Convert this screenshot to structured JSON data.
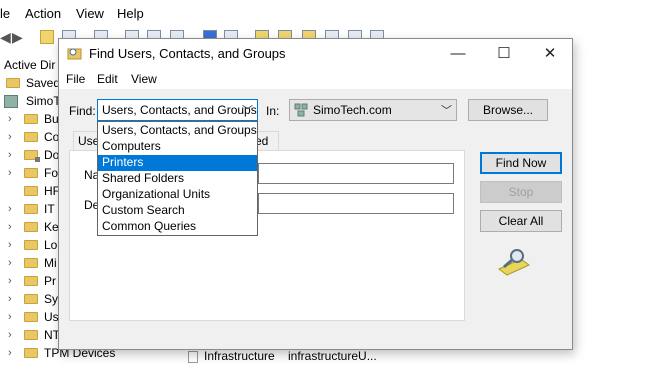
{
  "background": {
    "menu": [
      "le",
      "Action",
      "View",
      "Help"
    ],
    "tree": {
      "header": "Active Dir",
      "items": [
        {
          "label": "Saved",
          "type": "folder",
          "chevron": false
        },
        {
          "label": "SimoT",
          "type": "domain",
          "chevron": false
        },
        {
          "label": "Bu",
          "type": "folder",
          "chevron": true
        },
        {
          "label": "Co",
          "type": "folder",
          "chevron": true
        },
        {
          "label": "Do",
          "type": "folder",
          "chevron": true
        },
        {
          "label": "Fo",
          "type": "folder",
          "chevron": true
        },
        {
          "label": "HF",
          "type": "folder",
          "chevron": false
        },
        {
          "label": "IT",
          "type": "folder",
          "chevron": true
        },
        {
          "label": "Ke",
          "type": "folder",
          "chevron": true
        },
        {
          "label": "Lo",
          "type": "folder",
          "chevron": true
        },
        {
          "label": "Mi",
          "type": "folder",
          "chevron": true
        },
        {
          "label": "Pr",
          "type": "folder",
          "chevron": true
        },
        {
          "label": "Sy",
          "type": "folder",
          "chevron": true
        },
        {
          "label": "Us",
          "type": "folder",
          "chevron": true
        },
        {
          "label": "NT",
          "type": "folder",
          "chevron": true
        },
        {
          "label": "TPM Devices",
          "type": "folder",
          "chevron": true
        }
      ]
    },
    "results_row": {
      "name": "Infrastructure",
      "type_text": "infrastructureU..."
    }
  },
  "dialog": {
    "title": "Find Users, Contacts, and Groups",
    "menu": [
      "File",
      "Edit",
      "View"
    ],
    "find_label": "Find:",
    "find_value": "Users, Contacts, and Groups",
    "in_label": "In:",
    "in_value": "SimoTech.com",
    "browse_label": "Browse...",
    "tabs": [
      "Use",
      "ced"
    ],
    "fields": [
      "Na",
      "De"
    ],
    "buttons": {
      "find_now": "Find Now",
      "stop": "Stop",
      "clear_all": "Clear All"
    },
    "find_options": [
      "Users, Contacts, and Groups",
      "Computers",
      "Printers",
      "Shared Folders",
      "Organizational Units",
      "Custom Search",
      "Common Queries"
    ],
    "selected_option": "Printers"
  },
  "colors": {
    "accent": "#0078d7",
    "dialog_bg": "#f0f0f0",
    "folder": "#e9c765"
  }
}
